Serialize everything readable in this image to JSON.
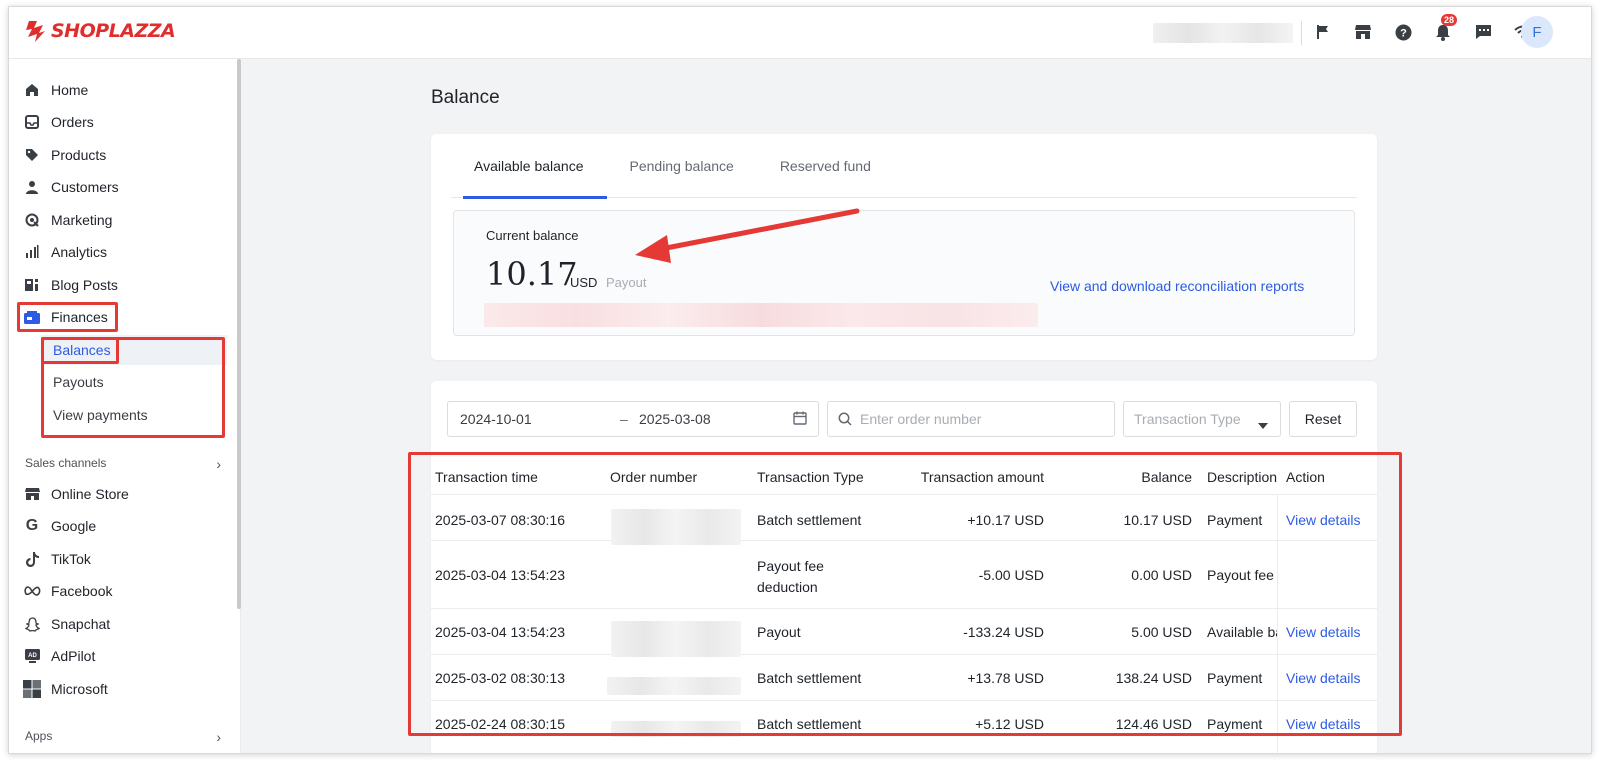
{
  "brand": {
    "name": "SHOPLAZZA",
    "color": "#e02e2e"
  },
  "topbar": {
    "icons": [
      "flag-icon",
      "store-icon",
      "help-icon",
      "bell-icon",
      "chat-icon",
      "wifi-icon"
    ],
    "notifications_count": "28",
    "avatar_initial": "F"
  },
  "sidebar": {
    "items": [
      {
        "label": "Home",
        "icon": "home-icon"
      },
      {
        "label": "Orders",
        "icon": "inbox-icon"
      },
      {
        "label": "Products",
        "icon": "tag-icon"
      },
      {
        "label": "Customers",
        "icon": "person-icon"
      },
      {
        "label": "Marketing",
        "icon": "megaphone-icon"
      },
      {
        "label": "Analytics",
        "icon": "bar-chart-icon"
      },
      {
        "label": "Blog Posts",
        "icon": "blog-icon"
      },
      {
        "label": "Finances",
        "icon": "wallet-icon"
      }
    ],
    "finance_sub": [
      {
        "label": "Balances"
      },
      {
        "label": "Payouts"
      },
      {
        "label": "View payments"
      }
    ],
    "sales_channels_label": "Sales channels",
    "channels": [
      {
        "label": "Online Store",
        "icon": "store-icon"
      },
      {
        "label": "Google",
        "icon": "google-icon"
      },
      {
        "label": "TikTok",
        "icon": "tiktok-icon"
      },
      {
        "label": "Facebook",
        "icon": "meta-icon"
      },
      {
        "label": "Snapchat",
        "icon": "ghost-icon"
      },
      {
        "label": "AdPilot",
        "icon": "adpilot-icon"
      },
      {
        "label": "Microsoft",
        "icon": "microsoft-icon"
      }
    ],
    "apps_label": "Apps"
  },
  "page": {
    "title": "Balance",
    "tabs": [
      {
        "label": "Available balance"
      },
      {
        "label": "Pending balance"
      },
      {
        "label": "Reserved fund"
      }
    ],
    "balance": {
      "label": "Current balance",
      "amount": "10.17",
      "currency": "USD",
      "payout_label": "Payout",
      "report_link": "View and download reconciliation reports"
    }
  },
  "filters": {
    "start_date": "2024-10-01",
    "separator": "–",
    "end_date": "2025-03-08",
    "search_placeholder": "Enter order number",
    "type_placeholder": "Transaction Type",
    "reset_label": "Reset"
  },
  "table": {
    "headers": {
      "time": "Transaction time",
      "order": "Order number",
      "type": "Transaction Type",
      "amount": "Transaction amount",
      "balance": "Balance",
      "description": "Description",
      "action": "Action"
    },
    "rows": [
      {
        "time": "2025-03-07 08:30:16",
        "type_line1": "Batch settlement",
        "type_line2": "",
        "amount": "+10.17 USD",
        "balance": "10.17 USD",
        "description": "Payment",
        "action": "View details"
      },
      {
        "time": "2025-03-04 13:54:23",
        "type_line1": "Payout fee",
        "type_line2": "deduction",
        "amount": "-5.00 USD",
        "balance": "0.00 USD",
        "description": "Payout fee d",
        "action": ""
      },
      {
        "time": "2025-03-04 13:54:23",
        "type_line1": "Payout",
        "type_line2": "",
        "amount": "-133.24 USD",
        "balance": "5.00 USD",
        "description": "Available ba",
        "action": "View details"
      },
      {
        "time": "2025-03-02 08:30:13",
        "type_line1": "Batch settlement",
        "type_line2": "",
        "amount": "+13.78 USD",
        "balance": "138.24 USD",
        "description": "Payment",
        "action": "View details"
      },
      {
        "time": "2025-02-24 08:30:15",
        "type_line1": "Batch settlement",
        "type_line2": "",
        "amount": "+5.12 USD",
        "balance": "124.46 USD",
        "description": "Payment",
        "action": "View details"
      }
    ]
  },
  "colors": {
    "accent": "#2d5be3",
    "highlight": "#e53935",
    "background": "#f2f3f5"
  }
}
